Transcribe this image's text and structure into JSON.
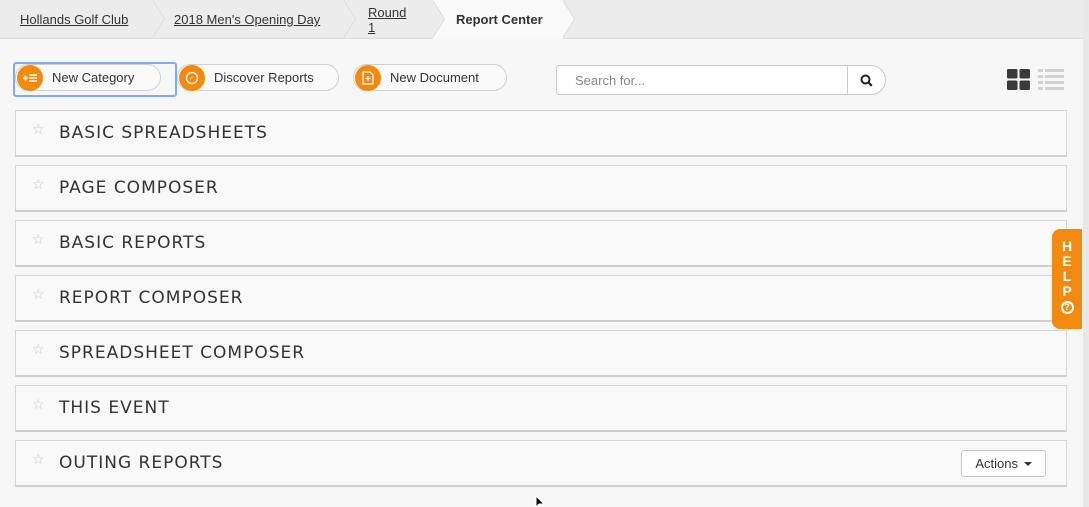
{
  "breadcrumb": [
    {
      "label": "Hollands Golf Club"
    },
    {
      "label": "2018 Men's Opening Day"
    },
    {
      "label": "Round 1"
    },
    {
      "label": "Report Center"
    }
  ],
  "toolbar": {
    "new_category": "New Category",
    "discover_reports": "Discover Reports",
    "new_document": "New Document"
  },
  "search": {
    "placeholder": "Search for..."
  },
  "categories": [
    {
      "title": "BASIC SPREADSHEETS"
    },
    {
      "title": "PAGE COMPOSER"
    },
    {
      "title": "BASIC REPORTS"
    },
    {
      "title": "REPORT COMPOSER"
    },
    {
      "title": "SPREADSHEET COMPOSER"
    },
    {
      "title": "THIS EVENT"
    },
    {
      "title": "OUTING REPORTS"
    }
  ],
  "actions_label": "Actions",
  "help": {
    "letters": [
      "H",
      "E",
      "L",
      "P"
    ],
    "icon_text": "?"
  },
  "colors": {
    "accent": "#f28a10",
    "focus": "#7aaef0"
  }
}
